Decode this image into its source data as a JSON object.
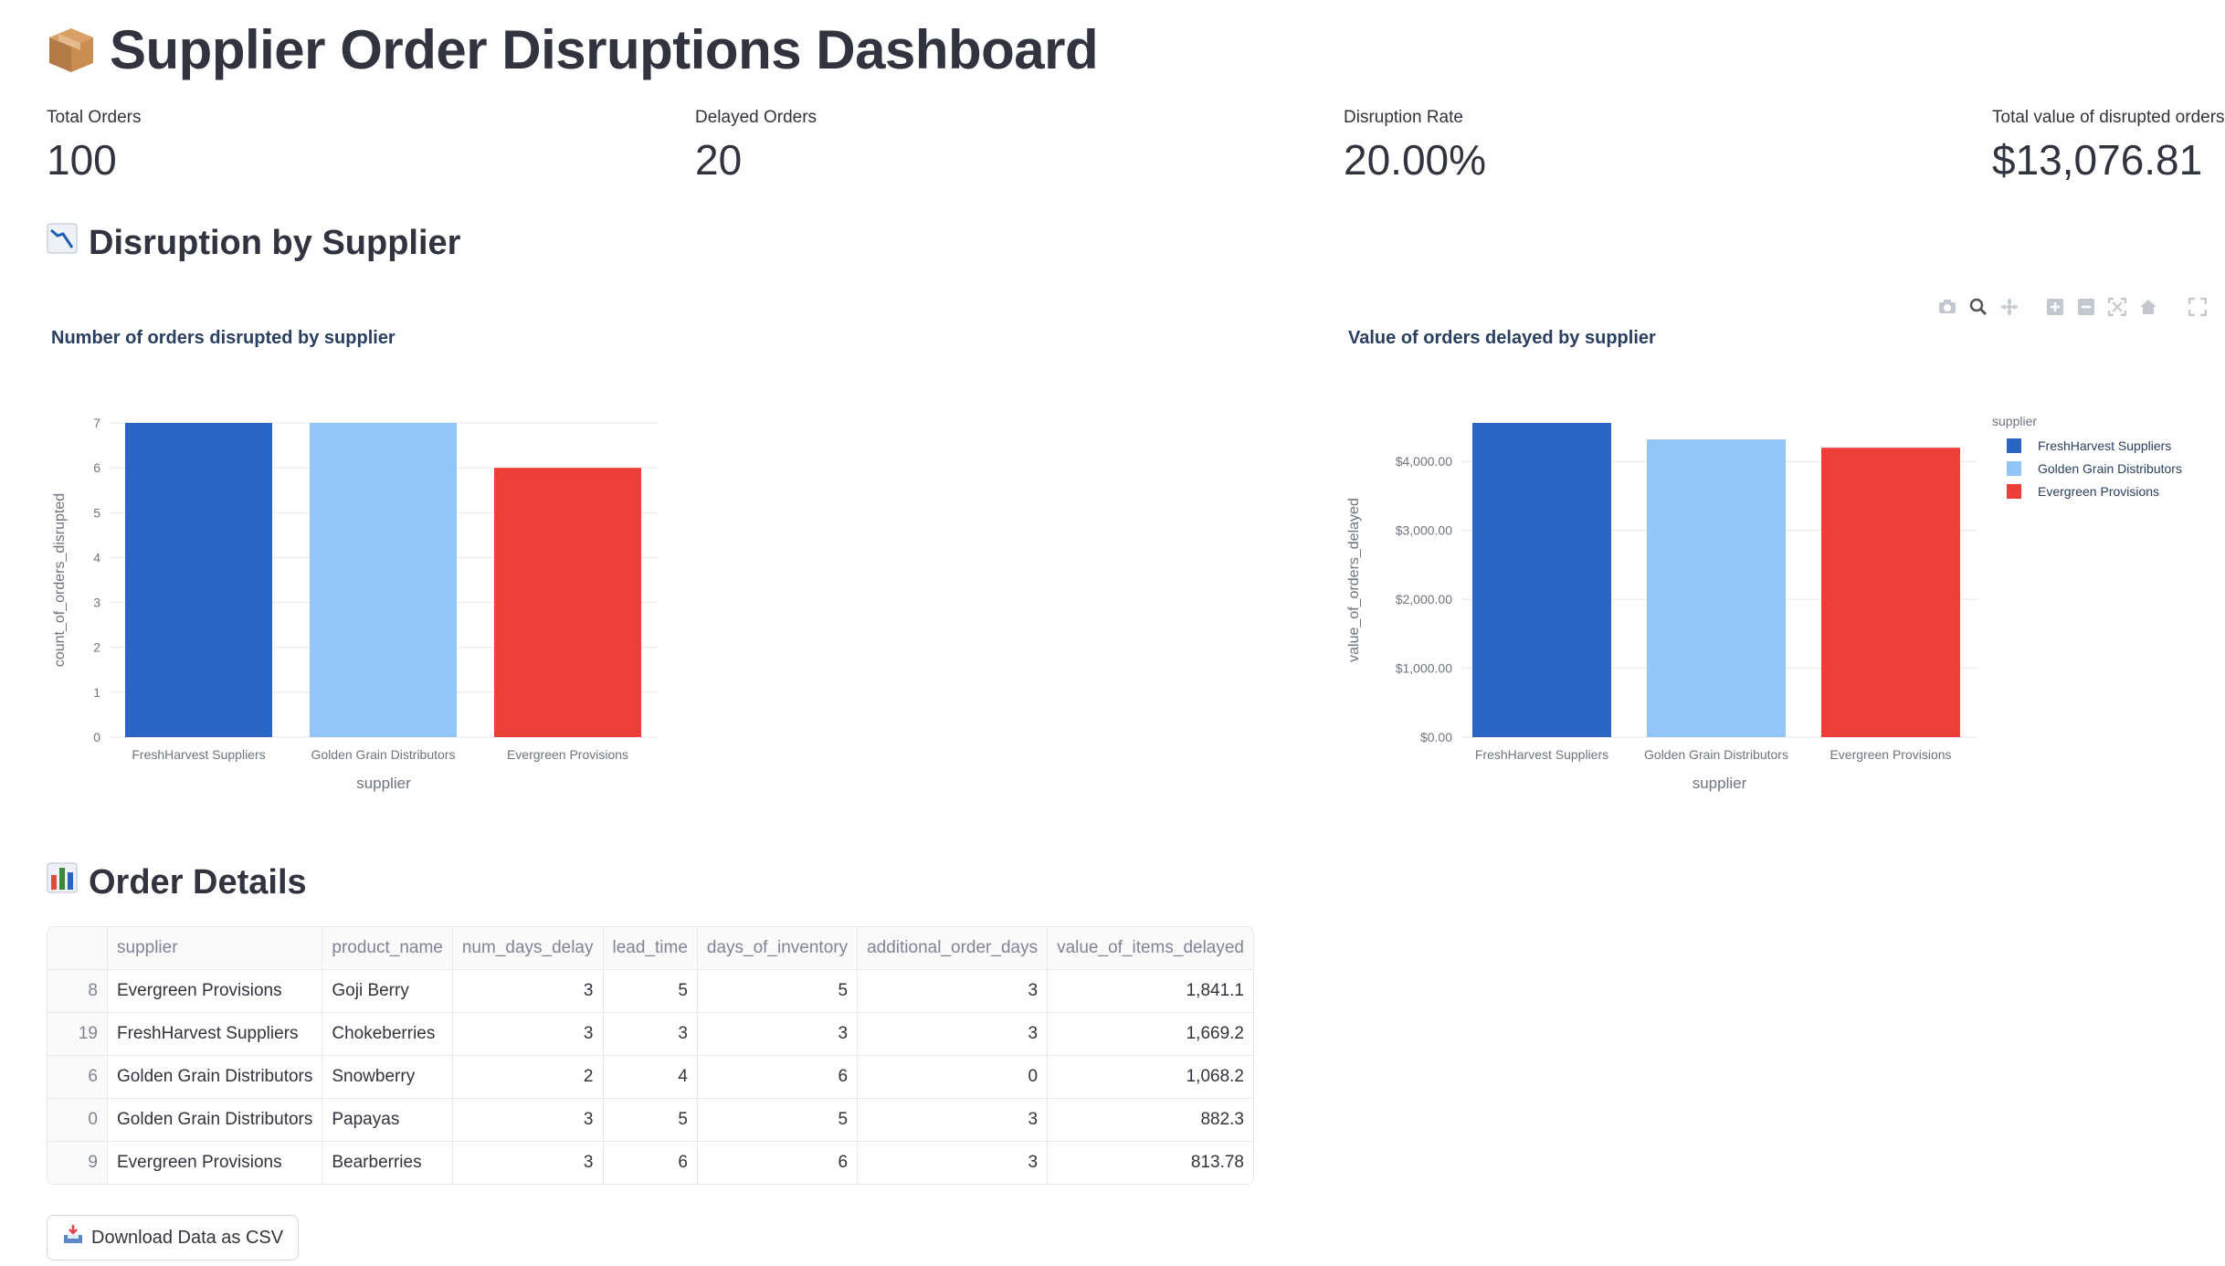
{
  "header": {
    "title": "Supplier Order Disruptions Dashboard",
    "icon": "package-icon"
  },
  "metrics": [
    {
      "label": "Total Orders",
      "value": "100"
    },
    {
      "label": "Delayed Orders",
      "value": "20"
    },
    {
      "label": "Disruption Rate",
      "value": "20.00%"
    },
    {
      "label": "Total value of disrupted orders",
      "value": "$13,076.81"
    }
  ],
  "section_supplier": {
    "title": "Disruption by Supplier",
    "icon": "chart-decreasing-icon"
  },
  "section_details": {
    "title": "Order Details",
    "icon": "bar-chart-icon"
  },
  "modebar": [
    "camera-icon",
    "zoom-icon",
    "pan-icon",
    "zoom-in-icon",
    "zoom-out-icon",
    "autoscale-icon",
    "home-icon",
    "fullscreen-icon"
  ],
  "chart_data": [
    {
      "type": "bar",
      "title": "Number of orders disrupted by supplier",
      "xlabel": "supplier",
      "ylabel": "count_of_orders_disrupted",
      "categories": [
        "FreshHarvest Suppliers",
        "Golden Grain Distributors",
        "Evergreen Provisions"
      ],
      "values": [
        7,
        7,
        6
      ],
      "colors": [
        "#2a65c4",
        "#93c6f8",
        "#ec3f3a"
      ],
      "ylim": [
        0,
        7
      ],
      "yticks": [
        "0",
        "1",
        "2",
        "3",
        "4",
        "5",
        "6",
        "7"
      ],
      "grid": true
    },
    {
      "type": "bar",
      "title": "Value of orders delayed by supplier",
      "xlabel": "supplier",
      "ylabel": "value_of_orders_delayed",
      "categories": [
        "FreshHarvest Suppliers",
        "Golden Grain Distributors",
        "Evergreen Provisions"
      ],
      "values": [
        4560,
        4320,
        4200
      ],
      "colors": [
        "#2a65c4",
        "#93c6f8",
        "#ec3f3a"
      ],
      "ylim": [
        0,
        4560
      ],
      "ytick_values": [
        0,
        1000,
        2000,
        3000,
        4000
      ],
      "yticks": [
        "$0.00",
        "$1,000.00",
        "$2,000.00",
        "$3,000.00",
        "$4,000.00"
      ],
      "legend": {
        "title": "supplier",
        "position": "top-right",
        "items": [
          "FreshHarvest Suppliers",
          "Golden Grain Distributors",
          "Evergreen Provisions"
        ]
      },
      "grid": true
    }
  ],
  "table": {
    "columns": [
      "",
      "supplier",
      "product_name",
      "num_days_delay",
      "lead_time",
      "days_of_inventory",
      "additional_order_days",
      "value_of_items_delayed"
    ],
    "rows": [
      [
        "8",
        "Evergreen Provisions",
        "Goji Berry",
        "3",
        "5",
        "5",
        "3",
        "1,841.1"
      ],
      [
        "19",
        "FreshHarvest Suppliers",
        "Chokeberries",
        "3",
        "3",
        "3",
        "3",
        "1,669.2"
      ],
      [
        "6",
        "Golden Grain Distributors",
        "Snowberry",
        "2",
        "4",
        "6",
        "0",
        "1,068.2"
      ],
      [
        "0",
        "Golden Grain Distributors",
        "Papayas",
        "3",
        "5",
        "5",
        "3",
        "882.3"
      ],
      [
        "9",
        "Evergreen Provisions",
        "Bearberries",
        "3",
        "6",
        "6",
        "3",
        "813.78"
      ]
    ]
  },
  "download_button": {
    "label": "Download Data as CSV",
    "icon": "inbox-tray-icon"
  }
}
